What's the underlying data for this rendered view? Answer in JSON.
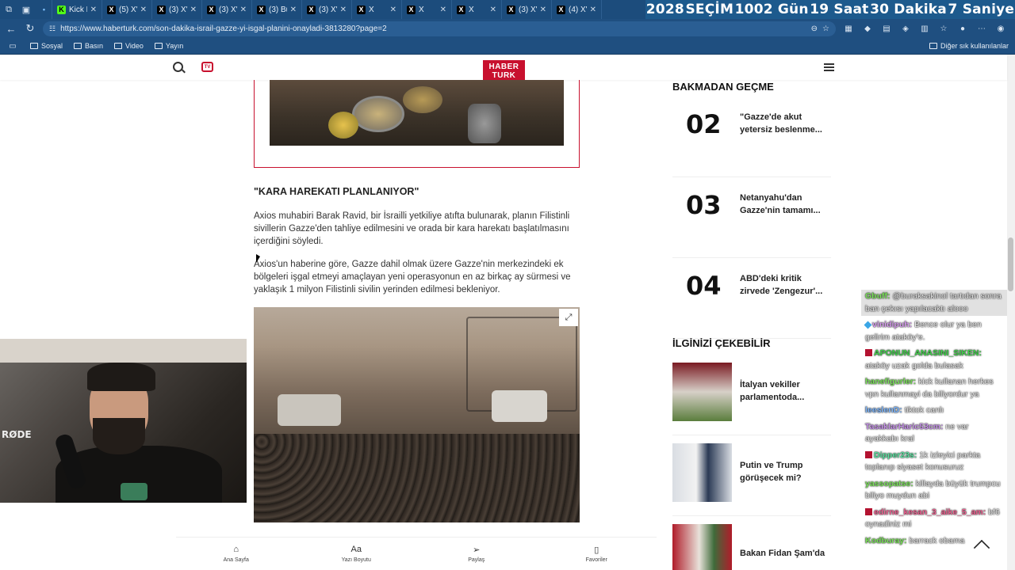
{
  "browser": {
    "tabs": [
      {
        "icon": "pin",
        "label": ""
      },
      {
        "icon": "kick",
        "label": "Kick Li"
      },
      {
        "icon": "x",
        "label": "(5) X'te"
      },
      {
        "icon": "x",
        "label": "(3) X'te"
      },
      {
        "icon": "x",
        "label": "(3) X'te"
      },
      {
        "icon": "x",
        "label": "(3) Bu"
      },
      {
        "icon": "x",
        "label": "(3) X'te"
      },
      {
        "icon": "x",
        "label": "X"
      },
      {
        "icon": "x",
        "label": "X"
      },
      {
        "icon": "x",
        "label": "X"
      },
      {
        "icon": "x",
        "label": "(3) X'te"
      },
      {
        "icon": "x",
        "label": "(4) X'te"
      }
    ],
    "countdown": [
      "2028",
      "SEÇİM",
      "1002 Gün",
      "19 Saat",
      "30 Dakika",
      "7 Saniye"
    ],
    "url": "https://www.haberturk.com/son-dakika-israil-gazze-yi-isgal-planini-onayladi-3813280?page=2",
    "bookmarks": [
      "Sosyal",
      "Basın",
      "Video",
      "Yayın"
    ],
    "bookmarks_other": "Diğer sık kullanılanlar"
  },
  "site": {
    "logo_top": "HABER",
    "logo_bottom": "TURK",
    "tv_label": "TV"
  },
  "article": {
    "subheading": "\"KARA HAREKATI PLANLANIYOR\"",
    "paragraph1": "Axios muhabiri Barak Ravid, bir İsrailli yetkiliye atıfta bulunarak, planın Filistinli sivillerin Gazze'den tahliye edilmesini ve orada bir kara harekatı başlatılmasını içerdiğini söyledi.",
    "paragraph2": "Axios'un haberine göre, Gazze dahil olmak üzere Gazze'nin merkezindeki ek bölgeleri işgal etmeyi amaçlayan yeni operasyonun en az birkaç ay sürmesi ve yaklaşık 1 milyon Filistinli sivilin yerinden edilmesi bekleniyor."
  },
  "sidebar": {
    "section1_title": "BAKMADAN GEÇME",
    "ranked": [
      {
        "num": "02",
        "title": "\"Gazze'de akut yetersiz beslenme..."
      },
      {
        "num": "03",
        "title": "Netanyahu'dan Gazze'nin tamamı..."
      },
      {
        "num": "04",
        "title": "ABD'deki kritik zirvede 'Zengezur'..."
      }
    ],
    "section2_title": "İLGİNİZİ ÇEKEBİLİR",
    "cards": [
      {
        "title": "İtalyan vekiller parlamentoda..."
      },
      {
        "title": "Putin ve Trump görüşecek mi?"
      },
      {
        "title": "Bakan Fidan Şam'da"
      }
    ]
  },
  "bottombar": [
    {
      "icon": "home-icon",
      "label": "Ana Sayfa"
    },
    {
      "icon": "font-size-icon",
      "label": "Yazı Boyutu"
    },
    {
      "icon": "share-icon",
      "label": "Paylaş"
    },
    {
      "icon": "bookmark-icon",
      "label": "Favoriler"
    }
  ],
  "webcam": {
    "mic_brand": "RØDE"
  },
  "chat": [
    {
      "user": "Gbuff:",
      "color": "#7be35a",
      "text": "@buraksakinol tartıdan sonra ban çekısı yapılacaktı alooo",
      "highlight": true,
      "badge": ""
    },
    {
      "user": "vinidipuh:",
      "color": "#d89cf0",
      "text": "Bence olur ya ben gelirim ataköy'e.",
      "badge": "gem"
    },
    {
      "user": "APONUN_ANASINI_SIKEN:",
      "color": "#41d14b",
      "text": "ataköy uzak golda bulasak",
      "badge": "red"
    },
    {
      "user": "hanefigurler:",
      "color": "#7be35a",
      "text": "kick kullanan herkes vpn kullanmayi da biliyordur ya",
      "badge": ""
    },
    {
      "user": "leeslenD:",
      "color": "#7fb8ff",
      "text": "tiktok canlı",
      "badge": ""
    },
    {
      "user": "TasaklarHaric53cm:",
      "color": "#c792ea",
      "text": "ne var ayakkabı kral",
      "badge": ""
    },
    {
      "user": "Dipper23s:",
      "color": "#5ae3a0",
      "text": "1k izleyici parkta toplanıp siyaset konusuruz",
      "badge": "red"
    },
    {
      "user": "yassopatse:",
      "color": "#7be35a",
      "text": "killayda büyük trumpcu biliyo muydun abi",
      "badge": ""
    },
    {
      "user": "edirne_kesan_3_aike_5_am:",
      "color": "#f06292",
      "text": "bf6 oynadiniz mi",
      "badge": "red"
    },
    {
      "user": "Kodburay:",
      "color": "#7be35a",
      "text": "barrack obama",
      "badge": ""
    }
  ]
}
